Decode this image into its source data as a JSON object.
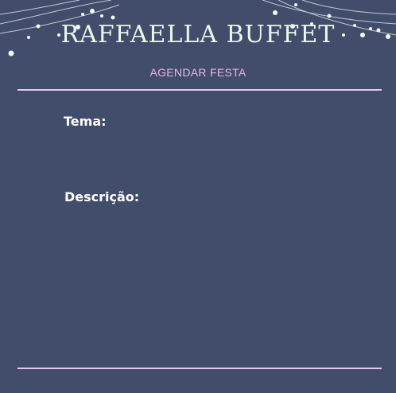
{
  "header": {
    "title": "RAFFAELLA BUFFET",
    "subtitle": "AGENDAR FESTA"
  },
  "form": {
    "tema_label": "Tema:",
    "tema_value": "",
    "descricao_label": "Descrição:",
    "descricao_value": ""
  },
  "colors": {
    "background": "#424d6b",
    "title": "#eaf7ec",
    "subtitle": "#e3b7e2",
    "divider": "#e8c8e6",
    "lights": "#f4f7f2"
  },
  "decoration": {
    "icon": "string-lights-icon"
  }
}
